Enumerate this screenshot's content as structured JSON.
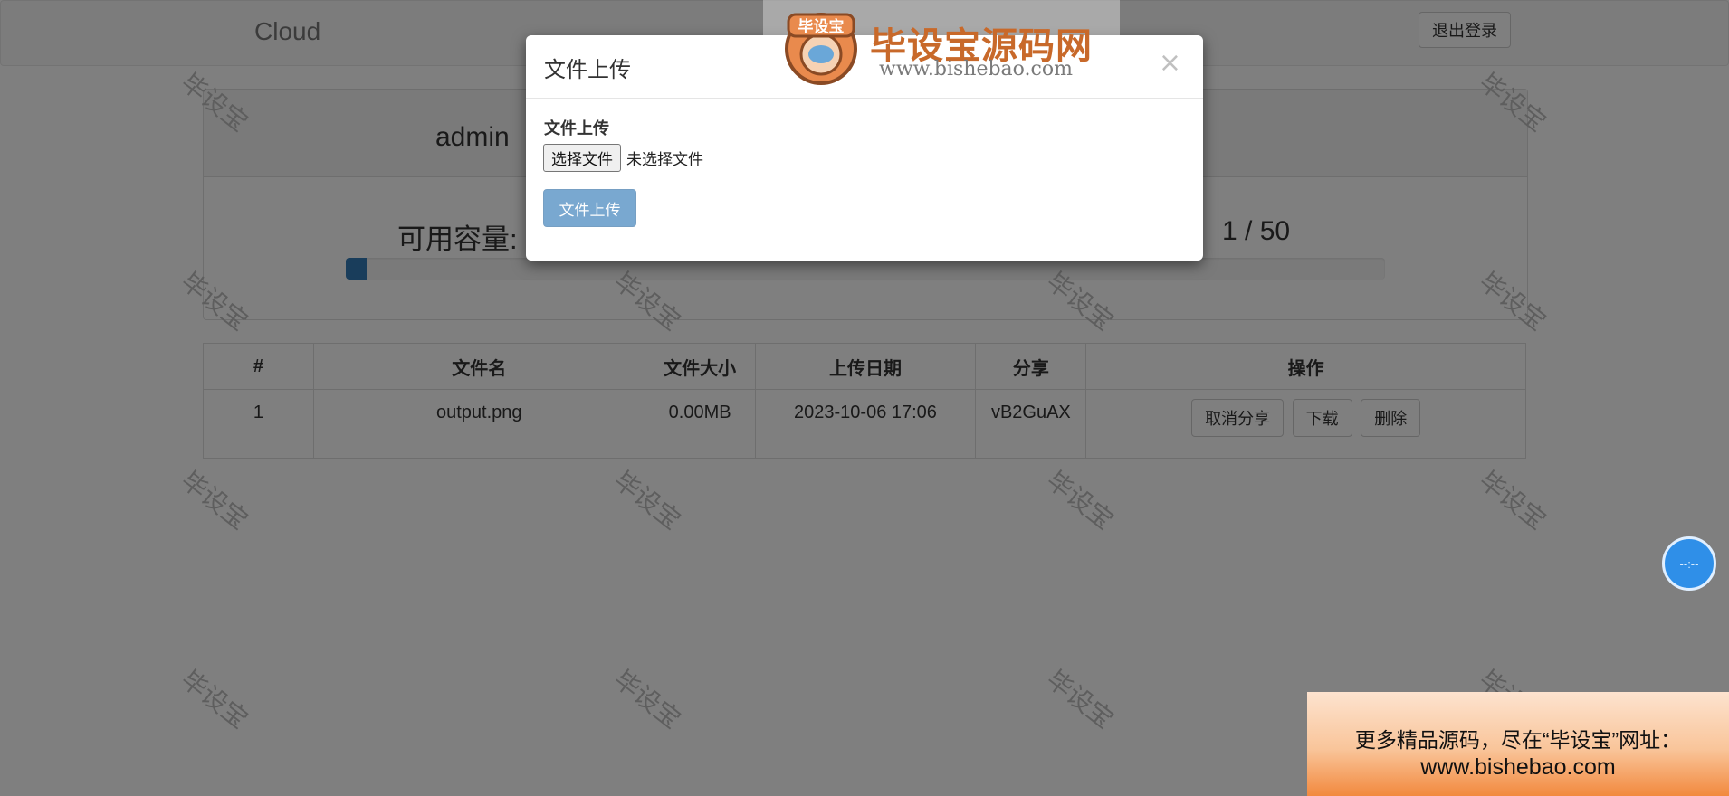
{
  "navbar": {
    "brand": "Cloud",
    "logout_label": "退出登录"
  },
  "user_panel": {
    "username": "admin",
    "capacity_label": "可用容量:",
    "file_count": "1 / 50",
    "progress_fraction": 0.02
  },
  "table": {
    "columns": [
      "#",
      "文件名",
      "文件大小",
      "上传日期",
      "分享",
      "操作"
    ],
    "rows": [
      {
        "index": "1",
        "filename": "output.png",
        "size": "0.00MB",
        "date": "2023-10-06 17:06",
        "share_code": "vB2GuAX",
        "actions": [
          "取消分享",
          "下载",
          "删除"
        ]
      }
    ]
  },
  "modal": {
    "title": "文件上传",
    "close": "×",
    "field_label": "文件上传",
    "choose_button": "选择文件",
    "no_file_text": "未选择文件",
    "submit_label": "文件上传"
  },
  "watermark": {
    "text": "毕设宝",
    "logo_title": "毕设宝源码网",
    "logo_url": "www.bishebao.com",
    "mascot_text": "毕设宝"
  },
  "float_button": {
    "text": "--:--"
  },
  "promo": {
    "line1": "更多精品源码，尽在“毕设宝”网址：",
    "line2": "www.bishebao.com"
  }
}
